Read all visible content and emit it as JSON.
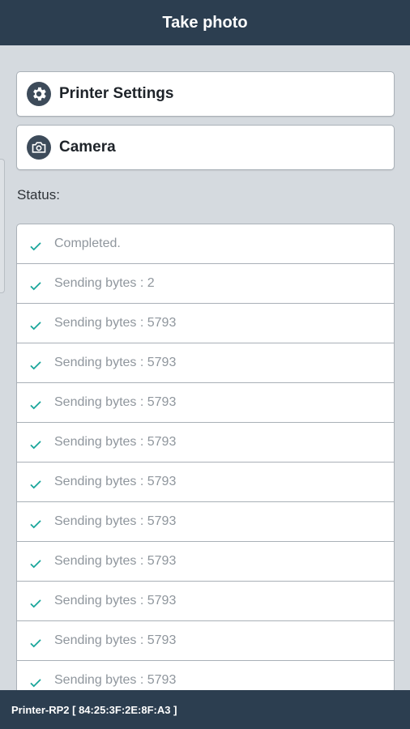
{
  "header": {
    "title": "Take photo"
  },
  "menu": {
    "printer_settings": {
      "label": "Printer Settings",
      "icon": "gear-icon"
    },
    "camera": {
      "label": "Camera",
      "icon": "camera-icon"
    }
  },
  "status": {
    "label": "Status:",
    "items": [
      "Completed.",
      "Sending bytes : 2",
      "Sending bytes : 5793",
      "Sending bytes : 5793",
      "Sending bytes : 5793",
      "Sending bytes : 5793",
      "Sending bytes : 5793",
      "Sending bytes : 5793",
      "Sending bytes : 5793",
      "Sending bytes : 5793",
      "Sending bytes : 5793",
      "Sending bytes : 5793"
    ]
  },
  "footer": {
    "device": "Printer-RP2 [ 84:25:3F:2E:8F:A3 ]"
  },
  "colors": {
    "bar": "#2c3e50",
    "background": "#d5dadf",
    "check": "#1aa69b",
    "icon_circle": "#3d4b5a"
  }
}
